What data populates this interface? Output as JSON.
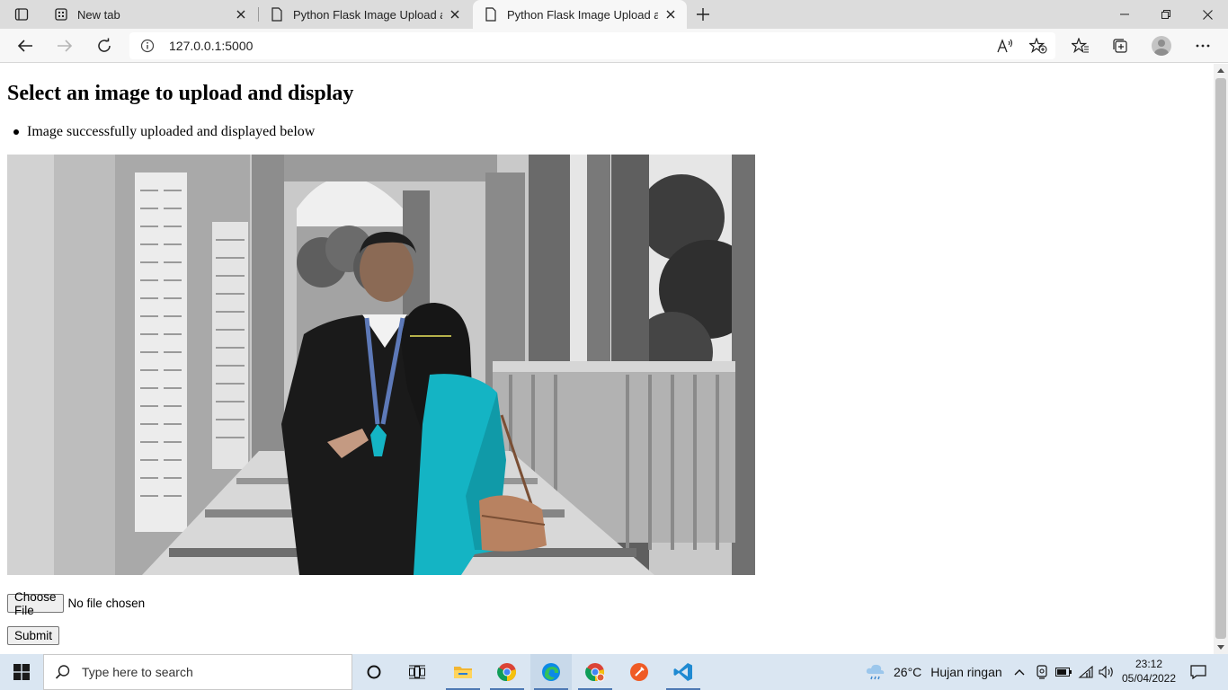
{
  "browser": {
    "tabs": [
      {
        "title": "New tab",
        "active": false
      },
      {
        "title": "Python Flask Image Upload and Display",
        "active": false
      },
      {
        "title": "Python Flask Image Upload and Display",
        "active": true
      }
    ],
    "address": {
      "url": "127.0.0.1:5000"
    }
  },
  "page": {
    "heading": "Select an image to upload and display",
    "flash_messages": [
      "Image successfully uploaded and displayed below"
    ],
    "file_input": {
      "button_label": "Choose File",
      "status": "No file chosen"
    },
    "submit_label": "Submit"
  },
  "taskbar": {
    "search_placeholder": "Type here to search",
    "apps": [
      "task-view",
      "file-explorer",
      "chrome",
      "edge",
      "chrome-canary",
      "postman",
      "vscode"
    ],
    "weather": {
      "temp": "26°C",
      "condition": "Hujan ringan"
    },
    "clock": {
      "time": "23:12",
      "date": "05/04/2022"
    }
  },
  "colors": {
    "tabstrip": "#dcdcdc",
    "toolbar": "#f7f7f7",
    "taskbar": "#dae6f2",
    "teal_accent": "#14b4c4"
  }
}
